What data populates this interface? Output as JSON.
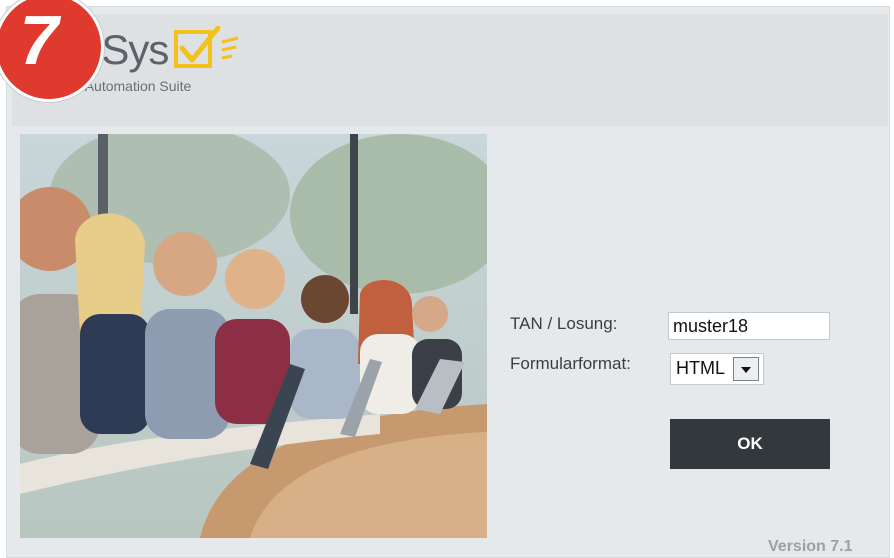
{
  "badge": {
    "number": "7"
  },
  "logo": {
    "word": "EvaSys",
    "tagline": "Survey Automation Suite"
  },
  "hero_photo": {
    "icon": "lecture-hall-students-photo"
  },
  "form": {
    "tan_label": "TAN / Losung:",
    "tan_value": "muster18",
    "format_label": "Formularformat:",
    "format_value": "HTML",
    "format_dropdown_icon": "chevron-down-icon",
    "ok_label": "OK"
  },
  "footer": {
    "version": "Version 7.1"
  },
  "colors": {
    "accent_yellow": "#f2c21a",
    "badge_red": "#e03a2e",
    "button_dark": "#33383c",
    "header_bg": "#dde1e4"
  }
}
